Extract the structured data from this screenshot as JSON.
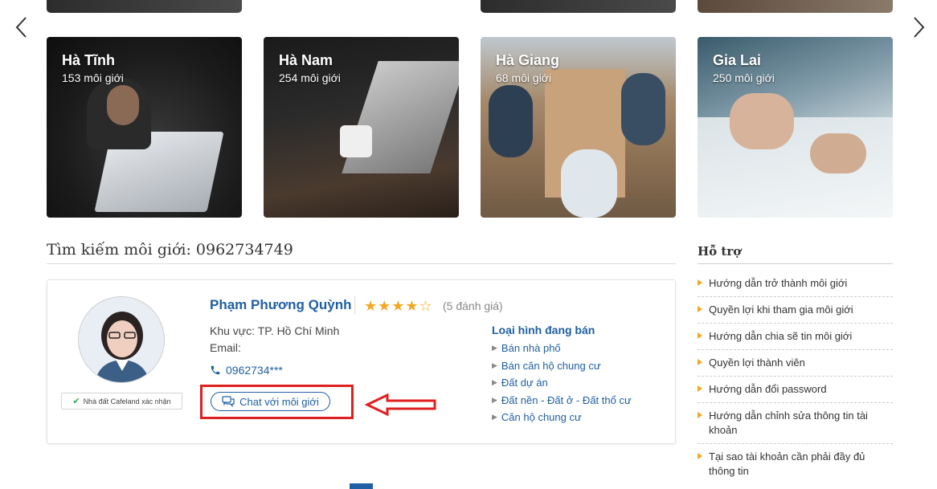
{
  "cities": [
    {
      "name": "Hà Tĩnh",
      "count": "153 môi giới"
    },
    {
      "name": "Hà Nam",
      "count": "254 môi giới"
    },
    {
      "name": "Hà Giang",
      "count": "68 môi giới"
    },
    {
      "name": "Gia Lai",
      "count": "250 môi giới"
    }
  ],
  "search": {
    "title": "Tìm kiếm môi giới: 0962734749"
  },
  "broker": {
    "name": "Phạm Phương Quỳnh",
    "stars": "★★★★☆",
    "reviews": "(5 đánh giá)",
    "area": "Khu vực: TP. Hồ Chí Minh",
    "email": "Email:",
    "phone": "0962734***",
    "verified": "Nhà đất Cafeland xác nhận",
    "chat_label": "Chat với môi giới",
    "types_title": "Loại hình đang bán",
    "types": [
      "Bán nhà phố",
      "Bán căn hộ chung cư",
      "Đất dự án",
      "Đất nền - Đất ở - Đất thổ cư",
      "Căn hộ chung cư"
    ]
  },
  "support": {
    "title": "Hỗ trợ",
    "items": [
      "Hướng dẫn trở thành môi giới",
      "Quyền lợi khi tham gia môi giới",
      "Hướng dẫn chia sẽ tin môi giới",
      "Quyền lợi thành viên",
      "Hướng dẫn đổi password",
      "Hướng dẫn chỉnh sửa thông tin tài khoản",
      "Tại sao tài khoản cần phải đầy đủ thông tin"
    ]
  },
  "colors": {
    "link": "#1f5fa3",
    "star": "#f5a623",
    "highlight": "#e02020"
  }
}
